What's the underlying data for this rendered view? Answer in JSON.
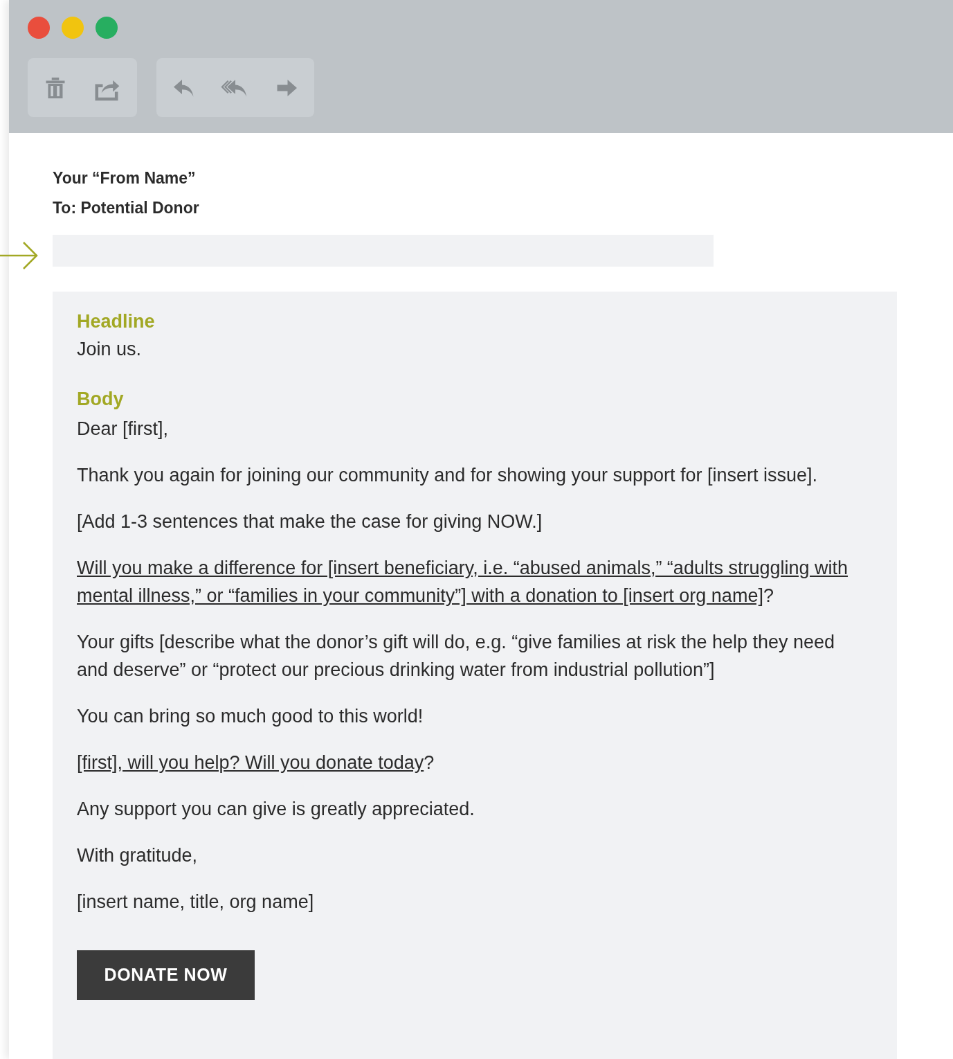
{
  "window": {
    "buttons": [
      {
        "color": "#e94e3d"
      },
      {
        "color": "#f1c40f"
      },
      {
        "color": "#27ae60"
      }
    ]
  },
  "toolbar": {
    "groups": [
      [
        {
          "kind": "delete"
        },
        {
          "kind": "share"
        }
      ],
      [
        {
          "kind": "reply"
        },
        {
          "kind": "reply-all"
        },
        {
          "kind": "forward"
        }
      ]
    ]
  },
  "header": {
    "from": "Your “From Name”",
    "to": "To: Potential Donor"
  },
  "email": {
    "headline_label": "Headline",
    "headline": "Join us.",
    "body_label": "Body",
    "paragraphs": [
      {
        "kind": "text",
        "text": "Dear [first],"
      },
      {
        "kind": "text",
        "text": "Thank you again for joining our community and for showing your support for [insert issue]."
      },
      {
        "kind": "text",
        "text": "[Add 1-3 sentences that make the case for giving NOW.]"
      },
      {
        "kind": "link",
        "link": "Will you make a difference for [insert beneficiary, i.e. “abused animals,” “adults struggling with mental illness,” or “families in your community”] with a donation to [insert org name]",
        "text": "?"
      },
      {
        "kind": "text",
        "text": "Your gifts [describe what the donor’s gift will do, e.g. “give families at risk the help they need and deserve” or “protect our precious drinking water from industrial pollution”]"
      },
      {
        "kind": "text",
        "text": "You can bring so much good to this world!"
      },
      {
        "kind": "link",
        "link": "[first], will you help? Will you donate today",
        "text": "?"
      },
      {
        "kind": "text",
        "text": "Any support you can give is greatly appreciated."
      },
      {
        "kind": "text",
        "text": "With gratitude,"
      },
      {
        "kind": "text",
        "text": "[insert name, title, org name]"
      }
    ],
    "button": "DONATE NOW"
  }
}
